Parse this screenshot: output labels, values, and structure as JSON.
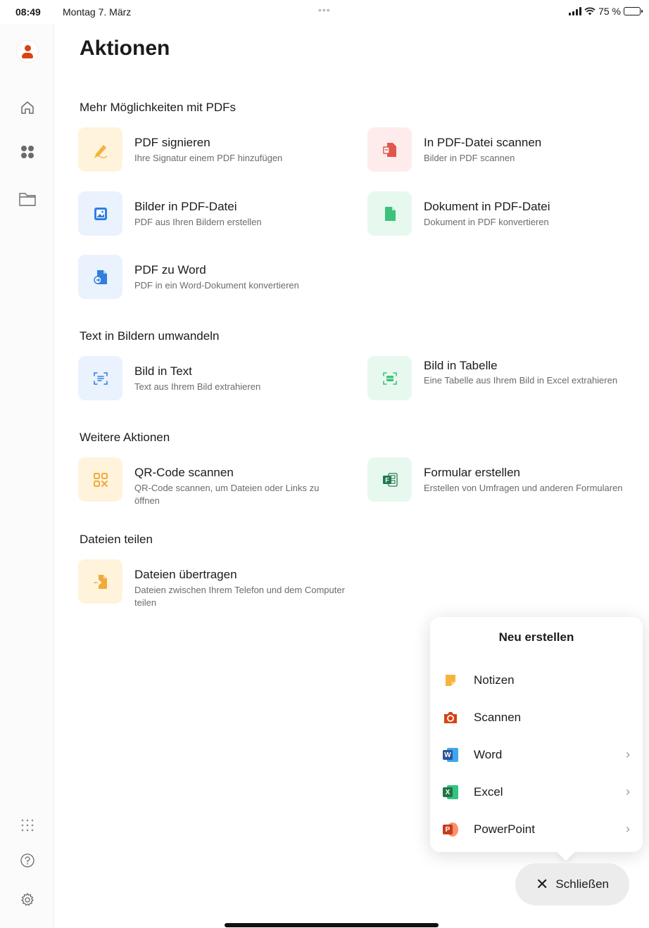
{
  "status_bar": {
    "time": "08:49",
    "date": "Montag 7. März",
    "dots": "•••",
    "battery": "75 %",
    "battery_level": 0.75
  },
  "sidebar": {
    "items": [
      "account",
      "home",
      "apps",
      "files"
    ],
    "bottom": [
      "all-apps",
      "help",
      "settings"
    ]
  },
  "page": {
    "title": "Aktionen"
  },
  "sections": {
    "pdf": {
      "title": "Mehr Möglichkeiten mit PDFs",
      "actions": [
        {
          "title": "PDF signieren",
          "desc": "Ihre Signatur einem PDF hinzufügen",
          "icon": "signature-icon"
        },
        {
          "title": "In PDF-Datei scannen",
          "desc": "Bilder in PDF scannen",
          "icon": "scan-to-pdf-icon"
        },
        {
          "title": "Bilder in PDF-Datei",
          "desc": "PDF aus Ihren Bildern erstellen",
          "icon": "image-to-pdf-icon"
        },
        {
          "title": "Dokument in PDF-Datei",
          "desc": "Dokument in PDF konvertieren",
          "icon": "document-to-pdf-icon"
        },
        {
          "title": "PDF zu Word",
          "desc": "PDF in ein Word-Dokument konvertieren",
          "icon": "pdf-to-word-icon"
        }
      ]
    },
    "images": {
      "title": "Text in Bildern umwandeln",
      "actions": [
        {
          "title": "Bild in Text",
          "desc": "Text aus Ihrem Bild extrahieren",
          "icon": "image-to-text-icon"
        },
        {
          "title": "Bild in Tabelle",
          "desc": "Eine Tabelle aus Ihrem Bild in Excel extrahieren",
          "icon": "image-to-table-icon"
        }
      ]
    },
    "more": {
      "title": "Weitere Aktionen",
      "actions": [
        {
          "title": "QR-Code scannen",
          "desc": "QR-Code scannen, um Dateien oder Links zu öffnen",
          "icon": "qr-code-icon"
        },
        {
          "title": "Formular erstellen",
          "desc": "Erstellen von Umfragen und anderen Formularen",
          "icon": "forms-icon"
        }
      ]
    },
    "share": {
      "title": "Dateien teilen",
      "actions": [
        {
          "title": "Dateien übertragen",
          "desc": "Dateien zwischen Ihrem Telefon und dem Computer teilen",
          "icon": "file-transfer-icon"
        }
      ]
    }
  },
  "popover": {
    "title": "Neu erstellen",
    "items": [
      {
        "label": "Notizen",
        "icon": "sticky-note-icon"
      },
      {
        "label": "Scannen",
        "icon": "camera-icon"
      },
      {
        "label": "Word",
        "icon": "word-icon"
      },
      {
        "label": "Excel",
        "icon": "excel-icon"
      },
      {
        "label": "PowerPoint",
        "icon": "powerpoint-icon"
      }
    ],
    "chevron": "›"
  },
  "close_button": {
    "label": "Schließen",
    "icon": "close-icon"
  },
  "colors": {
    "accent": "#d74315",
    "word": "#2b579a",
    "excel": "#217346",
    "powerpoint": "#c43e1c",
    "notes": "#f5b53d"
  }
}
